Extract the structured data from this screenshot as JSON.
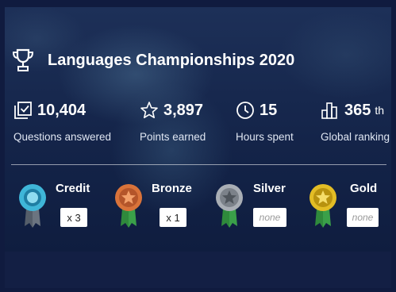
{
  "header": {
    "title": "Languages Championships 2020",
    "icon": "trophy-icon"
  },
  "stats": [
    {
      "icon": "checkbox-icon",
      "value": "10,404",
      "suffix": "",
      "label": "Questions answered"
    },
    {
      "icon": "star-outline-icon",
      "value": "3,897",
      "suffix": "",
      "label": "Points earned"
    },
    {
      "icon": "clock-icon",
      "value": "15",
      "suffix": "",
      "label": "Hours spent"
    },
    {
      "icon": "bar-chart-icon",
      "value": "365",
      "suffix": "th",
      "label": "Global ranking"
    }
  ],
  "awards": [
    {
      "name": "Credit",
      "count": "x 3",
      "medal_color": "#3fb6d8",
      "ribbon_color": "#555e6a"
    },
    {
      "name": "Bronze",
      "count": "x 1",
      "medal_color": "#d9733a",
      "ribbon_color": "#2f8a3c"
    },
    {
      "name": "Silver",
      "count": "none",
      "medal_color": "#8e949c",
      "ribbon_color": "#2f8a3c"
    },
    {
      "name": "Gold",
      "count": "none",
      "medal_color": "#d8b21e",
      "ribbon_color": "#2f8a3c"
    }
  ],
  "colors": {
    "background": "#101b3f",
    "panel": "#1a2c54",
    "text": "#ffffff"
  }
}
